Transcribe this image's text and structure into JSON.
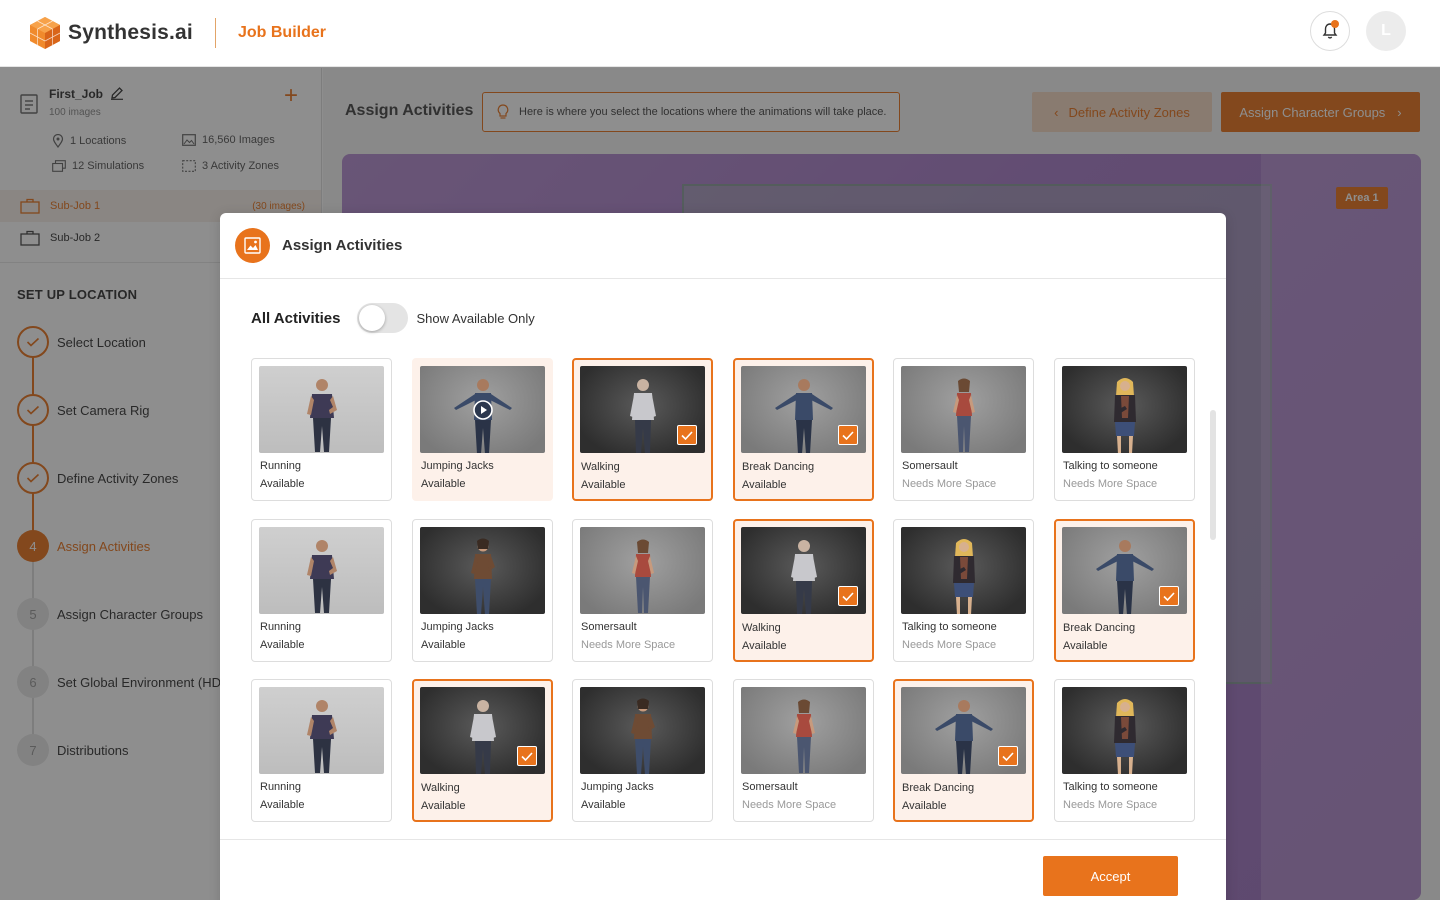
{
  "header": {
    "brand_name": "Synthesis.ai",
    "product_name": "Job Builder",
    "avatar_initial": "L"
  },
  "sidebar": {
    "job": {
      "title": "First_Job",
      "subtitle": "100 images",
      "locations": "1 Locations",
      "images": "16,560 Images",
      "simulations": "12 Simulations",
      "zones": "3 Activity Zones"
    },
    "subjobs": [
      {
        "label": "Sub-Job 1",
        "count": "(30 images)"
      },
      {
        "label": "Sub-Job 2",
        "count": ""
      }
    ],
    "section_title": "SET UP LOCATION",
    "steps": [
      {
        "marker": "",
        "label": "Select Location",
        "state": "done"
      },
      {
        "marker": "",
        "label": "Set Camera Rig",
        "state": "done"
      },
      {
        "marker": "",
        "label": "Define Activity Zones",
        "state": "done"
      },
      {
        "marker": "4",
        "label": "Assign Activities",
        "state": "current"
      },
      {
        "marker": "5",
        "label": "Assign Character Groups",
        "state": "todo"
      },
      {
        "marker": "6",
        "label": "Set Global Environment (HDRI)",
        "state": "todo"
      },
      {
        "marker": "7",
        "label": "Distributions",
        "state": "todo"
      }
    ]
  },
  "main": {
    "title": "Assign Activities",
    "hint": "Here is where you select the locations where the animations will take place.",
    "prev_label": "Define Activity Zones",
    "next_label": "Assign Character Groups",
    "area_badge": "Area 1"
  },
  "modal": {
    "title": "Assign Activities",
    "filter_title": "All Activities",
    "toggle_label": "Show Available Only",
    "toggle_on": false,
    "accept_label": "Accept",
    "cards": [
      {
        "name": "Running",
        "status": "Available",
        "selected": false,
        "preview": false,
        "thumb": "light",
        "figure": "man-tshirt"
      },
      {
        "name": "Jumping Jacks",
        "status": "Available",
        "selected": false,
        "preview": true,
        "thumb": "mid",
        "figure": "man-tpose"
      },
      {
        "name": "Walking",
        "status": "Available",
        "selected": true,
        "preview": false,
        "thumb": "dark",
        "figure": "old-man"
      },
      {
        "name": "Break Dancing",
        "status": "Available",
        "selected": true,
        "preview": false,
        "thumb": "mid",
        "figure": "man-tpose"
      },
      {
        "name": "Somersault",
        "status": "Needs More Space",
        "selected": false,
        "preview": false,
        "thumb": "mid",
        "figure": "woman-red"
      },
      {
        "name": "Talking to someone",
        "status": "Needs More Space",
        "selected": false,
        "preview": false,
        "thumb": "dark",
        "figure": "woman-blonde"
      },
      {
        "name": "Running",
        "status": "Available",
        "selected": false,
        "preview": false,
        "thumb": "light",
        "figure": "man-tshirt"
      },
      {
        "name": "Jumping Jacks",
        "status": "Available",
        "selected": false,
        "preview": false,
        "thumb": "dark",
        "figure": "woman-brown"
      },
      {
        "name": "Somersault",
        "status": "Needs More Space",
        "selected": false,
        "preview": false,
        "thumb": "mid",
        "figure": "woman-red"
      },
      {
        "name": "Walking",
        "status": "Available",
        "selected": true,
        "preview": false,
        "thumb": "dark",
        "figure": "old-man"
      },
      {
        "name": "Talking to someone",
        "status": "Needs More Space",
        "selected": false,
        "preview": false,
        "thumb": "dark",
        "figure": "woman-blonde"
      },
      {
        "name": "Break Dancing",
        "status": "Available",
        "selected": true,
        "preview": false,
        "thumb": "mid",
        "figure": "man-tpose"
      },
      {
        "name": "Running",
        "status": "Available",
        "selected": false,
        "preview": false,
        "thumb": "light",
        "figure": "man-tshirt"
      },
      {
        "name": "Walking",
        "status": "Available",
        "selected": true,
        "preview": false,
        "thumb": "dark",
        "figure": "old-man"
      },
      {
        "name": "Jumping Jacks",
        "status": "Available",
        "selected": false,
        "preview": false,
        "thumb": "dark",
        "figure": "woman-brown"
      },
      {
        "name": "Somersault",
        "status": "Needs More Space",
        "selected": false,
        "preview": false,
        "thumb": "mid",
        "figure": "woman-red"
      },
      {
        "name": "Break Dancing",
        "status": "Available",
        "selected": true,
        "preview": false,
        "thumb": "mid",
        "figure": "man-tpose"
      },
      {
        "name": "Talking to someone",
        "status": "Needs More Space",
        "selected": false,
        "preview": false,
        "thumb": "dark",
        "figure": "woman-blonde"
      }
    ]
  },
  "colors": {
    "accent": "#e8731c",
    "overlay": "#1e1e1e"
  },
  "icons": {
    "logo": "synthesis-cube-logo",
    "bell": "bell-icon",
    "edit": "pencil-icon",
    "plus": "plus-icon",
    "hint": "lightbulb-icon",
    "modal": "image-icon",
    "check": "check-icon",
    "play": "play-icon"
  }
}
